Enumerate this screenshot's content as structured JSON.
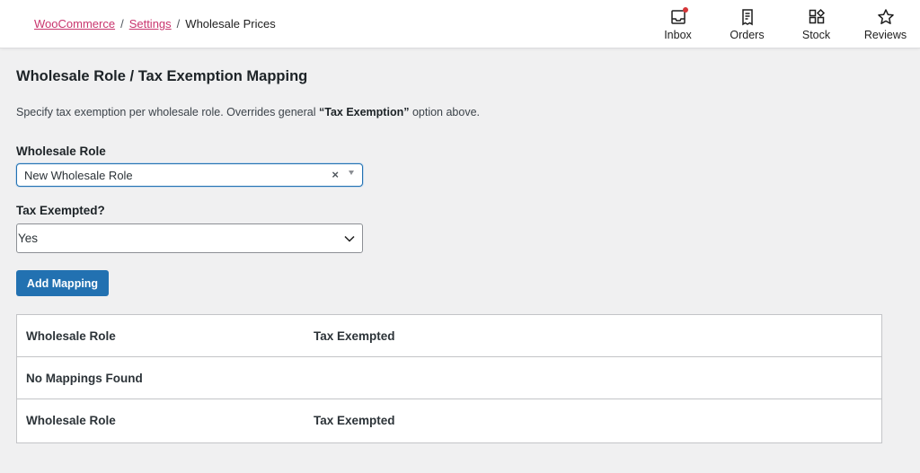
{
  "breadcrumb": {
    "items": [
      "WooCommerce",
      "Settings"
    ],
    "separator": "/",
    "current": "Wholesale Prices"
  },
  "header_actions": [
    {
      "label": "Inbox",
      "icon": "inbox-icon",
      "has_notification": true
    },
    {
      "label": "Orders",
      "icon": "orders-icon"
    },
    {
      "label": "Stock",
      "icon": "stock-icon"
    },
    {
      "label": "Reviews",
      "icon": "star-icon"
    }
  ],
  "section": {
    "title": "Wholesale Role / Tax Exemption Mapping",
    "description_prefix": "Specify tax exemption per wholesale role. Overrides general ",
    "description_bold": "“Tax Exemption”",
    "description_suffix": " option above."
  },
  "form": {
    "role_label": "Wholesale Role",
    "role_value": "New Wholesale Role",
    "role_clear": "×",
    "tax_label": "Tax Exempted?",
    "tax_value": "Yes",
    "add_button": "Add Mapping"
  },
  "table": {
    "header": [
      "Wholesale Role",
      "Tax Exempted"
    ],
    "empty_message": "No Mappings Found",
    "footer": [
      "Wholesale Role",
      "Tax Exempted"
    ]
  },
  "colors": {
    "link": "#c9356e",
    "primary": "#2271b1",
    "notification": "#d63638"
  }
}
